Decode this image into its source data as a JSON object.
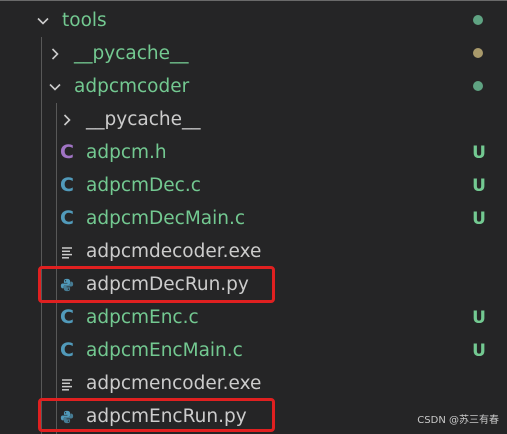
{
  "explorer": {
    "root": {
      "label": "tools",
      "color": "#73c991",
      "dot": "#5fa382"
    },
    "rows": [
      {
        "label": "__pycache__",
        "type": "folder",
        "color": "#73c991",
        "dot": "#a99a6b"
      },
      {
        "label": "adpcmcoder",
        "type": "folder",
        "color": "#73c991",
        "dot": "#5fa382"
      },
      {
        "label": "__pycache__",
        "type": "folder",
        "color": "#cccccc"
      },
      {
        "label": "adpcm.h",
        "type": "file",
        "icon": "c-header-icon",
        "icon_text": "C",
        "color": "#73c991",
        "status": "U"
      },
      {
        "label": "adpcmDec.c",
        "type": "file",
        "icon": "c-file-icon",
        "icon_text": "C",
        "color": "#73c991",
        "status": "U"
      },
      {
        "label": "adpcmDecMain.c",
        "type": "file",
        "icon": "c-file-icon",
        "icon_text": "C",
        "color": "#73c991",
        "status": "U"
      },
      {
        "label": "adpcmdecoder.exe",
        "type": "file",
        "icon": "text-lines-icon",
        "color": "#cccccc"
      },
      {
        "label": "adpcmDecRun.py",
        "type": "file",
        "icon": "python-icon",
        "color": "#cccccc"
      },
      {
        "label": "adpcmEnc.c",
        "type": "file",
        "icon": "c-file-icon",
        "icon_text": "C",
        "color": "#73c991",
        "status": "U"
      },
      {
        "label": "adpcmEncMain.c",
        "type": "file",
        "icon": "c-file-icon",
        "icon_text": "C",
        "color": "#73c991",
        "status": "U"
      },
      {
        "label": "adpcmencoder.exe",
        "type": "file",
        "icon": "text-lines-icon",
        "color": "#cccccc"
      },
      {
        "label": "adpcmEncRun.py",
        "type": "file",
        "icon": "python-icon",
        "color": "#cccccc"
      }
    ]
  },
  "colors": {
    "c_icon": "#519aba",
    "h_icon": "#a074c4",
    "highlight": "#e02020"
  },
  "watermark": "CSDN @苏三有春"
}
